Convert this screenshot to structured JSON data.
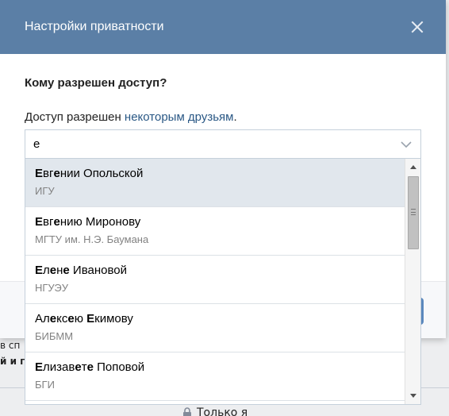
{
  "modal": {
    "title": "Настройки приватности",
    "question": "Кому разрешен доступ?",
    "access_prefix": "Доступ разрешен ",
    "access_link": "некоторым друзьям",
    "access_suffix": "."
  },
  "search": {
    "value": "е"
  },
  "suggestions": [
    {
      "name_parts": [
        {
          "t": "Е",
          "b": true
        },
        {
          "t": "вг",
          "b": false
        },
        {
          "t": "е",
          "b": true
        },
        {
          "t": "нии Опольской",
          "b": false
        }
      ],
      "sub": "ИГУ",
      "active": true
    },
    {
      "name_parts": [
        {
          "t": "Е",
          "b": true
        },
        {
          "t": "вг",
          "b": false
        },
        {
          "t": "е",
          "b": true
        },
        {
          "t": "нию Миронову",
          "b": false
        }
      ],
      "sub": "МГТУ им. Н.Э. Баумана",
      "active": false
    },
    {
      "name_parts": [
        {
          "t": "Е",
          "b": true
        },
        {
          "t": "л",
          "b": false
        },
        {
          "t": "е",
          "b": true
        },
        {
          "t": "н",
          "b": false
        },
        {
          "t": "е",
          "b": true
        },
        {
          "t": " Ивановой",
          "b": false
        }
      ],
      "sub": "НГУЭУ",
      "active": false
    },
    {
      "name_parts": [
        {
          "t": "Ал",
          "b": false
        },
        {
          "t": "е",
          "b": true
        },
        {
          "t": "кс",
          "b": false
        },
        {
          "t": "е",
          "b": true
        },
        {
          "t": "ю ",
          "b": false
        },
        {
          "t": "Е",
          "b": true
        },
        {
          "t": "кимову",
          "b": false
        }
      ],
      "sub": "БИБММ",
      "active": false
    },
    {
      "name_parts": [
        {
          "t": "Е",
          "b": true
        },
        {
          "t": "лизав",
          "b": false
        },
        {
          "t": "е",
          "b": true
        },
        {
          "t": "т",
          "b": false
        },
        {
          "t": "е",
          "b": true
        },
        {
          "t": " Поповой",
          "b": false
        }
      ],
      "sub": "БГИ",
      "active": false
    }
  ],
  "background": {
    "line1": "в сп",
    "line2": "й и г",
    "lock_label": "Только я"
  },
  "colors": {
    "header": "#5b7fa6",
    "link": "#2a5885",
    "active_row": "#e1e7ed"
  },
  "icons": {
    "close": "close-icon",
    "chevron": "chevron-down-icon",
    "lock": "lock-icon"
  }
}
